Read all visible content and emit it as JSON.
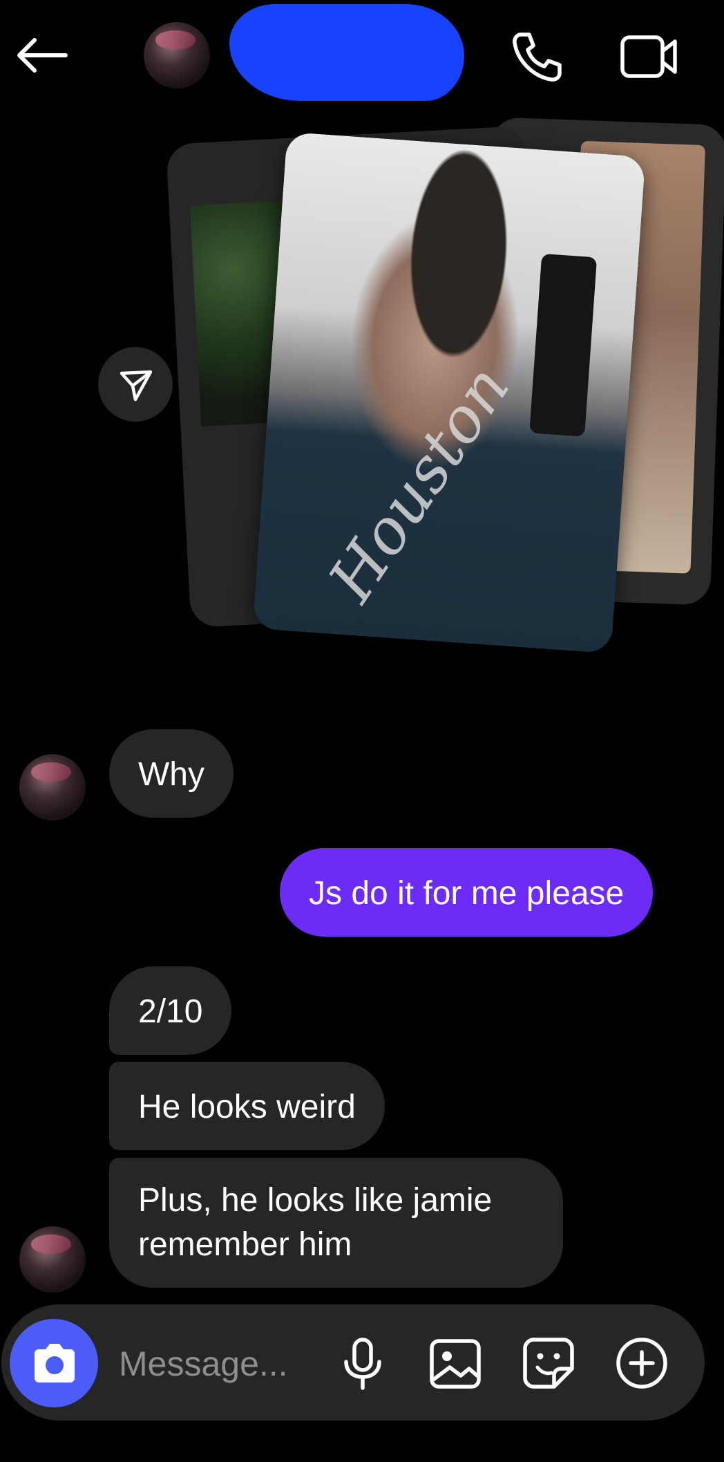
{
  "header": {
    "back_icon": "arrow-left-icon",
    "contact_name_redacted": true,
    "call_icon": "phone-icon",
    "video_icon": "video-camera-icon"
  },
  "shared_media": {
    "type": "photo-stack",
    "send_icon": "paper-plane-icon"
  },
  "messages": [
    {
      "sender": "them",
      "text": "Why"
    },
    {
      "sender": "me",
      "text": "Js do it for me please"
    },
    {
      "sender": "them",
      "text": "2/10"
    },
    {
      "sender": "them",
      "text": "He looks weird"
    },
    {
      "sender": "them",
      "text": "Plus, he looks like jamie remember  him"
    }
  ],
  "composer": {
    "placeholder": "Message...",
    "camera_icon": "camera-icon",
    "mic_icon": "microphone-icon",
    "gallery_icon": "image-icon",
    "sticker_icon": "sticker-icon",
    "more_icon": "plus-circle-icon"
  },
  "colors": {
    "background": "#000000",
    "incoming_bubble": "#262626",
    "outgoing_bubble": "#6c2cf6",
    "camera_button": "#4b5cf7",
    "redaction": "#1742ff"
  }
}
